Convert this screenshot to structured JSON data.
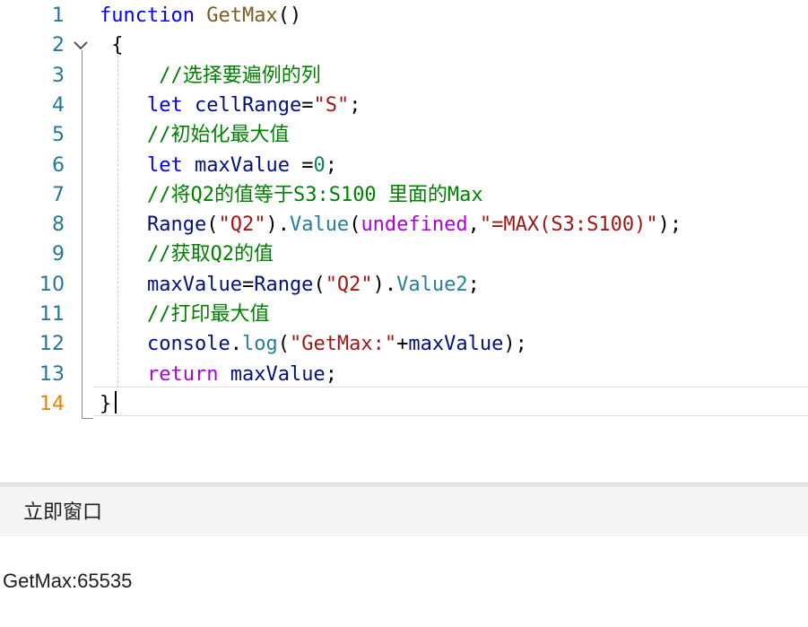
{
  "editor": {
    "active_line": 14,
    "lines": [
      {
        "n": "1",
        "tokens": [
          [
            "kw",
            "function"
          ],
          [
            "plain",
            " "
          ],
          [
            "fn",
            "GetMax"
          ],
          [
            "plain",
            "()"
          ]
        ]
      },
      {
        "n": "2",
        "fold": true,
        "tokens": [
          [
            "plain",
            " {"
          ]
        ]
      },
      {
        "n": "3",
        "tokens": [
          [
            "plain",
            "     "
          ],
          [
            "cm",
            "//选择要遍例的列"
          ]
        ]
      },
      {
        "n": "4",
        "tokens": [
          [
            "plain",
            "    "
          ],
          [
            "kw",
            "let"
          ],
          [
            "plain",
            " "
          ],
          [
            "id",
            "cellRange"
          ],
          [
            "plain",
            "="
          ],
          [
            "str",
            "\"S\""
          ],
          [
            "plain",
            ";"
          ]
        ]
      },
      {
        "n": "5",
        "tokens": [
          [
            "plain",
            "    "
          ],
          [
            "cm",
            "//初始化最大值"
          ]
        ]
      },
      {
        "n": "6",
        "tokens": [
          [
            "plain",
            "    "
          ],
          [
            "kw",
            "let"
          ],
          [
            "plain",
            " "
          ],
          [
            "id",
            "maxValue"
          ],
          [
            "plain",
            " ="
          ],
          [
            "num",
            "0"
          ],
          [
            "plain",
            ";"
          ]
        ]
      },
      {
        "n": "7",
        "tokens": [
          [
            "plain",
            "    "
          ],
          [
            "cm",
            "//将Q2的值等于S3:S100 里面的Max"
          ]
        ]
      },
      {
        "n": "8",
        "tokens": [
          [
            "plain",
            "    "
          ],
          [
            "id",
            "Range"
          ],
          [
            "plain",
            "("
          ],
          [
            "str",
            "\"Q2\""
          ],
          [
            "plain",
            ")."
          ],
          [
            "prop",
            "Value"
          ],
          [
            "plain",
            "("
          ],
          [
            "kw2",
            "undefined"
          ],
          [
            "plain",
            ","
          ],
          [
            "str",
            "\"=MAX(S3:S100)\""
          ],
          [
            "plain",
            ");"
          ]
        ]
      },
      {
        "n": "9",
        "tokens": [
          [
            "plain",
            "    "
          ],
          [
            "cm",
            "//获取Q2的值"
          ]
        ]
      },
      {
        "n": "10",
        "tokens": [
          [
            "plain",
            "    "
          ],
          [
            "id",
            "maxValue"
          ],
          [
            "plain",
            "="
          ],
          [
            "id",
            "Range"
          ],
          [
            "plain",
            "("
          ],
          [
            "str",
            "\"Q2\""
          ],
          [
            "plain",
            ")."
          ],
          [
            "prop",
            "Value2"
          ],
          [
            "plain",
            ";"
          ]
        ]
      },
      {
        "n": "11",
        "tokens": [
          [
            "plain",
            "    "
          ],
          [
            "cm",
            "//打印最大值"
          ]
        ]
      },
      {
        "n": "12",
        "tokens": [
          [
            "plain",
            "    "
          ],
          [
            "id",
            "console"
          ],
          [
            "plain",
            "."
          ],
          [
            "prop",
            "log"
          ],
          [
            "plain",
            "("
          ],
          [
            "str",
            "\"GetMax:\""
          ],
          [
            "plain",
            "+"
          ],
          [
            "id",
            "maxValue"
          ],
          [
            "plain",
            ");"
          ]
        ]
      },
      {
        "n": "13",
        "tokens": [
          [
            "plain",
            "    "
          ],
          [
            "kw2",
            "return"
          ],
          [
            "plain",
            " "
          ],
          [
            "id",
            "maxValue"
          ],
          [
            "plain",
            ";"
          ]
        ]
      },
      {
        "n": "14",
        "tokens": [
          [
            "plain",
            "}"
          ]
        ]
      }
    ]
  },
  "immediate_window": {
    "title": "立即窗口",
    "output": "GetMax:65535"
  },
  "colors": {
    "keyword": "#0000ff",
    "control_keyword": "#af00db",
    "function_name": "#795e26",
    "string": "#a31515",
    "number": "#098658",
    "comment": "#008000",
    "property": "#267f99",
    "identifier": "#001080",
    "line_number": "#237893",
    "active_line_number": "#e8820c"
  },
  "icons": {
    "fold": "chevron-down-icon"
  }
}
